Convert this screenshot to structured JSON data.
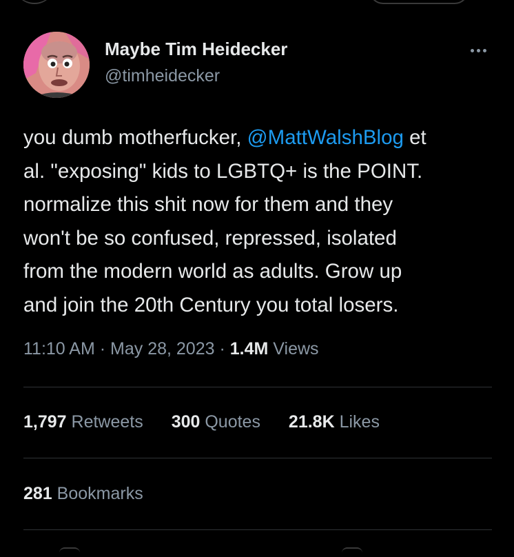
{
  "tweet": {
    "author": {
      "display_name": "Maybe Tim Heidecker",
      "handle": "@timheidecker"
    },
    "text_lines": [
      {
        "before": "you dumb motherfucker, ",
        "mention": "@MattWalshBlog",
        "after": " et"
      },
      {
        "text": "al. \"exposing\" kids to LGBTQ+ is the POINT."
      },
      {
        "text": "normalize this shit now for them and they"
      },
      {
        "text": "won't be so confused, repressed, isolated"
      },
      {
        "text": "from the modern world as adults. Grow up"
      },
      {
        "text": "and join the 20th Century you total losers."
      }
    ],
    "time": "11:10 AM",
    "separator": "·",
    "date": "May 28, 2023",
    "views_count": "1.4M",
    "views_label": "Views"
  },
  "stats": {
    "retweets": {
      "count": "1,797",
      "label": "Retweets"
    },
    "quotes": {
      "count": "300",
      "label": "Quotes"
    },
    "likes": {
      "count": "21.8K",
      "label": "Likes"
    },
    "bookmarks": {
      "count": "281",
      "label": "Bookmarks"
    }
  },
  "colors": {
    "background": "#000000",
    "text_primary": "#e7e9ea",
    "text_secondary": "#8b98a5",
    "link": "#1d9bf0",
    "divider": "#2f3336"
  },
  "icons": {
    "more": "more-horizontal-icon"
  }
}
